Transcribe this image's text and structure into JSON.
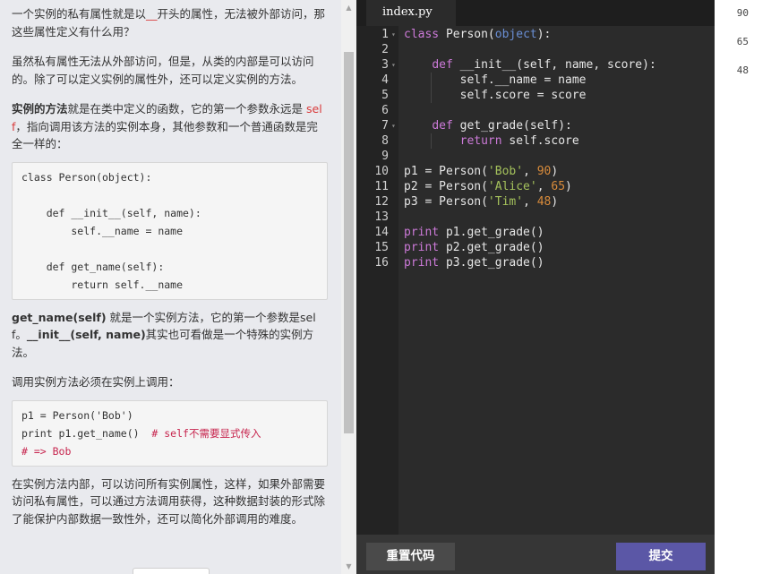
{
  "lesson": {
    "p1": [
      "一个实例的私有属性就是以",
      "__",
      "开头的属性，无法被外部访问，那这些属性定义有什么用？"
    ],
    "p2": "虽然私有属性无法从外部访问，但是，从类的内部是可以访问的。除了可以定义实例的属性外，还可以定义实例的方法。",
    "p3": [
      "实例的方法",
      "就是在类中定义的函数，它的第一个参数永远是 ",
      "self",
      "，指向调用该方法的实例本身，其他参数和一个普通函数是完全一样的："
    ],
    "code1": [
      "class Person(object):",
      "",
      "    def __init__(self, name):",
      "        self.__name = name",
      "",
      "    def get_name(self):",
      "        return self.__name"
    ],
    "p4": [
      "get_name(self)",
      " 就是一个实例方法，它的第一个参数是self。",
      "__init__(self, name)",
      "其实也可看做是一个特殊的实例方法。"
    ],
    "p5": "调用实例方法必须在实例上调用：",
    "code2": {
      "line1": "p1 = Person('Bob')",
      "line2_code": "print p1.get_name()  ",
      "line2_comment": "# self不需要显式传入",
      "line3": "# => Bob"
    },
    "p6": "在实例方法内部，可以访问所有实例属性，这样，如果外部需要访问私有属性，可以通过方法调用获得，这种数据封装的形式除了能保护内部数据一致性外，还可以简化外部调用的难度。"
  },
  "editor": {
    "tab": "index.py",
    "line_numbers": [
      "1",
      "2",
      "3",
      "4",
      "5",
      "6",
      "7",
      "8",
      "9",
      "10",
      "11",
      "12",
      "13",
      "14",
      "15",
      "16"
    ],
    "lines": [
      [
        [
          "kw",
          "class"
        ],
        [
          "fn",
          " Person("
        ],
        [
          "bi",
          "object"
        ],
        [
          "fn",
          "):"
        ]
      ],
      [],
      [
        [
          "fn",
          "    "
        ],
        [
          "kw",
          "def"
        ],
        [
          "fn",
          " __init__(self, name, score):"
        ]
      ],
      [
        [
          "fn",
          "        self.__name = name"
        ]
      ],
      [
        [
          "fn",
          "        self.score = score"
        ]
      ],
      [],
      [
        [
          "fn",
          "    "
        ],
        [
          "kw",
          "def"
        ],
        [
          "fn",
          " get_grade(self):"
        ]
      ],
      [
        [
          "fn",
          "        "
        ],
        [
          "kw",
          "return"
        ],
        [
          "fn",
          " self.score"
        ]
      ],
      [],
      [
        [
          "fn",
          "p1 = Person("
        ],
        [
          "str",
          "'Bob'"
        ],
        [
          "fn",
          ", "
        ],
        [
          "num",
          "90"
        ],
        [
          "fn",
          ")"
        ]
      ],
      [
        [
          "fn",
          "p2 = Person("
        ],
        [
          "str",
          "'Alice'"
        ],
        [
          "fn",
          ", "
        ],
        [
          "num",
          "65"
        ],
        [
          "fn",
          ")"
        ]
      ],
      [
        [
          "fn",
          "p3 = Person("
        ],
        [
          "str",
          "'Tim'"
        ],
        [
          "fn",
          ", "
        ],
        [
          "num",
          "48"
        ],
        [
          "fn",
          ")"
        ]
      ],
      [],
      [
        [
          "kw",
          "print"
        ],
        [
          "fn",
          " p1.get_grade()"
        ]
      ],
      [
        [
          "kw",
          "print"
        ],
        [
          "fn",
          " p2.get_grade()"
        ]
      ],
      [
        [
          "kw",
          "print"
        ],
        [
          "fn",
          " p3.get_grade()"
        ]
      ]
    ],
    "fold_lines": [
      1,
      3,
      7
    ],
    "reset_label": "重置代码",
    "submit_label": "提交"
  },
  "output": [
    "90",
    "65",
    "48"
  ]
}
